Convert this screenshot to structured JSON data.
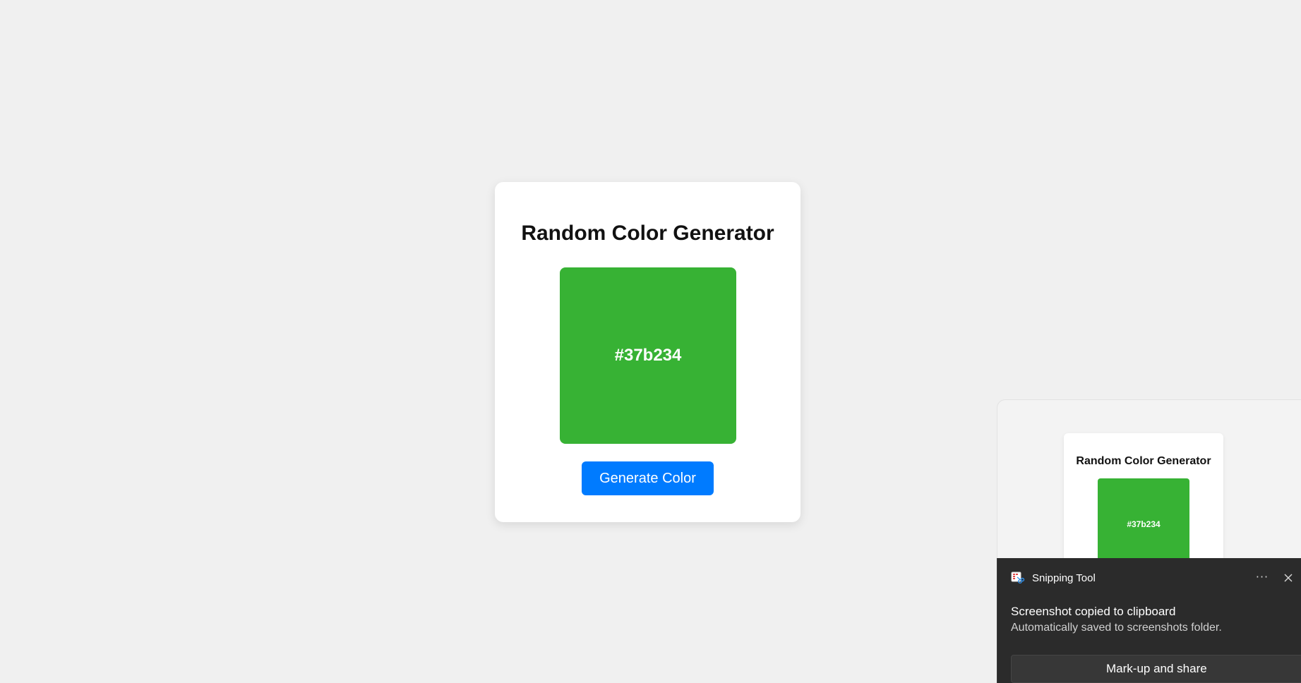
{
  "app": {
    "title": "Random Color Generator",
    "current_color_label": "#37b234",
    "generate_button_label": "Generate Color"
  },
  "colors": {
    "page_background": "#f0f0f0",
    "current_color": "#37b234",
    "button_background": "#007bff",
    "toast_background": "#2b2b2b"
  },
  "snipping_preview": {
    "title": "Random Color Generator",
    "color_label": "#37b234"
  },
  "toast": {
    "app_icon": "snipping-tool-icon",
    "app_name": "Snipping Tool",
    "more_label": "···",
    "close_icon": "close-icon",
    "heading": "Screenshot copied to clipboard",
    "body": "Automatically saved to screenshots folder.",
    "action_label": "Mark-up and share"
  }
}
